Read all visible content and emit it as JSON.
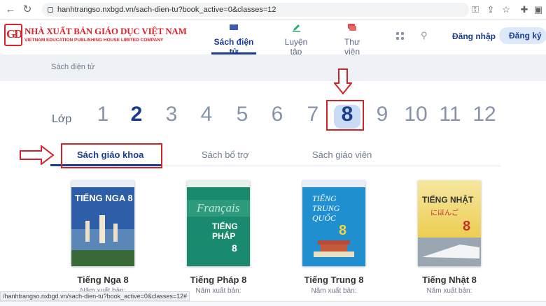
{
  "browser": {
    "url": "hanhtrangso.nxbgd.vn/sach-dien-tu?book_active=0&classes=12",
    "status_url": "/hanhtrangso.nxbgd.vn/sach-dien-tu?book_active=0&classes=12#"
  },
  "header": {
    "logo_mark": "GD",
    "logo_title": "NHÀ XUẤT BẢN GIÁO DỤC VIỆT NAM",
    "logo_subtitle": "VIETNAM EDUCATION PUBLISHING HOUSE LIMITED COMPANY",
    "nav": [
      {
        "label": "Sách điện tử",
        "icon": "book-icon",
        "active": true
      },
      {
        "label": "Luyện tập",
        "icon": "pencil-icon",
        "active": false
      },
      {
        "label": "Thư viện",
        "icon": "library-icon",
        "active": false
      }
    ],
    "login": "Đăng nhập",
    "register": "Đăng ký"
  },
  "breadcrumb": "Sách điện tử",
  "grades": {
    "label": "Lớp",
    "items": [
      "1",
      "2",
      "3",
      "4",
      "5",
      "6",
      "7",
      "8",
      "9",
      "10",
      "11",
      "12"
    ],
    "selected": "8"
  },
  "tabs": [
    "Sách giáo khoa",
    "Sách bổ trợ",
    "Sách giáo viên"
  ],
  "books": [
    {
      "title": "Tiếng Nga 8",
      "meta": "Năm xuất bản:",
      "cover": "TIẾNG NGA 8",
      "color": "#2e5ea8"
    },
    {
      "title": "Tiếng Pháp 8",
      "meta": "Năm xuất bản:",
      "cover": "TIẾNG PHÁP 8",
      "color": "#1a8a6e"
    },
    {
      "title": "Tiếng Trung 8",
      "meta": "Năm xuất bản:",
      "cover": "TIẾNG TRUNG QUỐC 8",
      "color": "#1f8fd0"
    },
    {
      "title": "Tiếng Nhật 8",
      "meta": "Năm xuất bản:",
      "cover": "TIẾNG NHẬT 8",
      "color": "#e8c02a"
    }
  ],
  "colors": {
    "accent": "#1a3b8f",
    "highlight": "#d0232a"
  }
}
